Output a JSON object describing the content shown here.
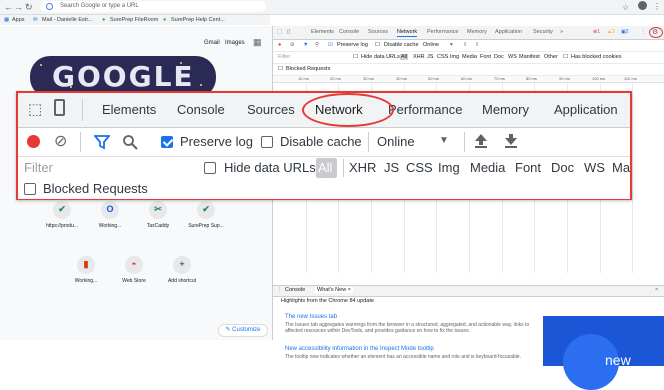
{
  "browser": {
    "omnibox_placeholder": "Search Google or type a URL",
    "bookmarks": [
      "Apps",
      "Mail - Danielle Estr...",
      "SurePrep FileRoom",
      "SurePrep Help Cent..."
    ]
  },
  "google_page": {
    "top_links": [
      "Gmail",
      "Images"
    ],
    "shortcuts_row1": [
      "https://produ...",
      "Working...",
      "TaxCaddy",
      "SurePrep Sup..."
    ],
    "shortcuts_row2": [
      "Working...",
      "Web Store",
      "Add shortcut"
    ],
    "add_symbol": "+",
    "customize": "Customize",
    "doodle_text": "GOOGLE"
  },
  "devtools_mini": {
    "tabs": [
      "Elements",
      "Console",
      "Sources",
      "Network",
      "Performance",
      "Memory",
      "Application",
      "Security",
      "»"
    ],
    "errors": "1",
    "warnings": "2",
    "info": "2",
    "toolbar": {
      "preserve_log": "Preserve log",
      "disable_cache": "Disable cache",
      "throttle": "Online"
    },
    "filter_placeholder": "Filter",
    "hide_data_urls": "Hide data URLs",
    "types": [
      "All",
      "XHR",
      "JS",
      "CSS",
      "Img",
      "Media",
      "Font",
      "Doc",
      "WS",
      "Manifest",
      "Other"
    ],
    "has_blocked_cookies": "Has blocked cookies",
    "blocked_requests": "Blocked Requests",
    "ruler_ticks": [
      "10 ms",
      "20 ms",
      "30 ms",
      "40 ms",
      "50 ms",
      "60 ms",
      "70 ms",
      "80 ms",
      "90 ms",
      "100 ms",
      "110 ms"
    ],
    "drawer_tabs": [
      "Console",
      "What's New ×"
    ],
    "whats_new_title": "Highlights from the Chrome 84 update",
    "items": [
      {
        "heading": "The new Issues tab",
        "body": "The Issues tab aggregates warnings from the browser in a structured, aggregated, and actionable way, links to affected resources within DevTools, and provides guidance on how to fix the issues."
      },
      {
        "heading": "New accessibility information in the Inspect Mode tooltip",
        "body": "The tooltip now indicates whether an element has an accessible name and role and is keyboard-focusable."
      }
    ],
    "video_word": "new"
  },
  "callout": {
    "tabs": [
      "Elements",
      "Console",
      "Sources",
      "Network",
      "Performance",
      "Memory",
      "Application"
    ],
    "preserve_log": "Preserve log",
    "disable_cache": "Disable cache",
    "throttle": "Online",
    "filter_placeholder": "Filter",
    "hide_data_urls": "Hide data URLs",
    "types": [
      "All",
      "XHR",
      "JS",
      "CSS",
      "Img",
      "Media",
      "Font",
      "Doc",
      "WS",
      "Mar"
    ],
    "blocked_requests": "Blocked Requests"
  },
  "colors": {
    "accent": "#1a73e8",
    "highlight": "#e53935",
    "record": "#e53935"
  }
}
